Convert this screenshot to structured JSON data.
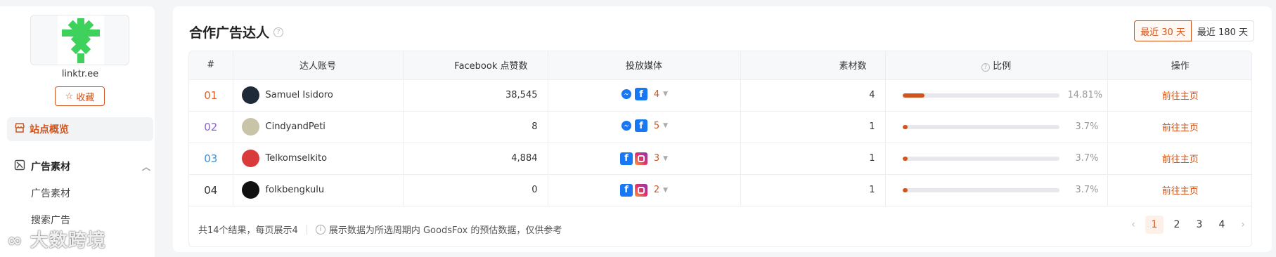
{
  "sidebar": {
    "site_name": "linktr.ee",
    "favorite_label": "收藏",
    "overview_label": "站点概览",
    "ad_group_label": "广告素材",
    "sub_items": [
      "广告素材",
      "搜索广告"
    ]
  },
  "watermark": "大数跨境",
  "main": {
    "title": "合作广告达人",
    "period_options": [
      "最近 30 天",
      "最近 180 天"
    ],
    "selected_period": "最近 30 天",
    "columns": [
      "#",
      "达人账号",
      "Facebook 点赞数",
      "投放媒体",
      "素材数",
      "比例",
      "操作"
    ],
    "rows": [
      {
        "idx": "01",
        "idx_color": "#e0602d",
        "account": "Samuel Isidoro",
        "avatar": "#1e2a38",
        "likes": "38,545",
        "media": [
          "messenger",
          "facebook"
        ],
        "media_count": "4",
        "materials": "4",
        "ratio": 14.81,
        "ratio_text": "14.81%",
        "action": "前往主页"
      },
      {
        "idx": "02",
        "idx_color": "#8a63d2",
        "account": "CindyandPeti",
        "avatar": "#c9c3a8",
        "likes": "8",
        "media": [
          "messenger",
          "facebook"
        ],
        "media_count": "5",
        "materials": "1",
        "ratio": 3.7,
        "ratio_text": "3.7%",
        "action": "前往主页"
      },
      {
        "idx": "03",
        "idx_color": "#3f8fd8",
        "account": "Telkomselkito",
        "avatar": "#d93a3a",
        "likes": "4,884",
        "media": [
          "facebook",
          "instagram"
        ],
        "media_count": "3",
        "materials": "1",
        "ratio": 3.7,
        "ratio_text": "3.7%",
        "action": "前往主页"
      },
      {
        "idx": "04",
        "idx_color": "#333333",
        "account": "folkbengkulu",
        "avatar": "#111111",
        "likes": "0",
        "media": [
          "facebook",
          "instagram"
        ],
        "media_count": "2",
        "materials": "1",
        "ratio": 3.7,
        "ratio_text": "3.7%",
        "action": "前往主页"
      }
    ],
    "footer_summary": "共14个结果，每页展示4",
    "footer_note": "展示数据为所选周期内 GoodsFox 的预估数据，仅供参考",
    "pages": [
      "1",
      "2",
      "3",
      "4"
    ],
    "current_page": "1"
  },
  "colors": {
    "accent": "#d2541a",
    "facebook": "#1877f2"
  }
}
